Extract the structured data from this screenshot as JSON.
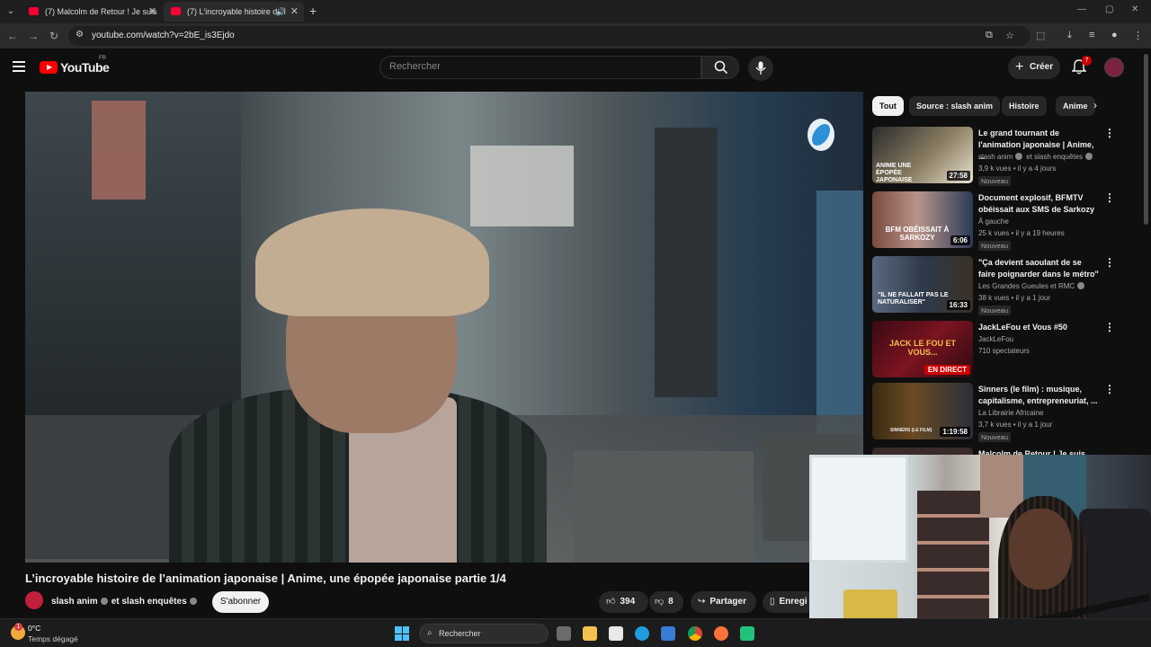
{
  "browser": {
    "tabs": [
      {
        "label": "(7) Malcolm de Retour ! Je suis"
      },
      {
        "label": "(7) L'incroyable histoire de l"
      }
    ],
    "url": "youtube.com/watch?v=2bE_is3Ejdo"
  },
  "header": {
    "logo_text": "YouTube",
    "country": "FR",
    "search_placeholder": "Rechercher",
    "create_label": "Créer",
    "notifications_count": "7"
  },
  "video": {
    "title": "L’incroyable histoire de l’animation japonaise | Anime, une épopée japonaise partie 1/4",
    "channel_name": "slash anim",
    "channel_joiner": "et slash enquêtes",
    "subscribe_label": "S'abonner",
    "likes": "394",
    "dislikes": "8",
    "share_label": "Partager",
    "save_label": "Enregi"
  },
  "chips": [
    "Tout",
    "Source : slash anim",
    "Histoire",
    "Anime"
  ],
  "recommendations": [
    {
      "title": "Le grand tournant de l'animation japonaise | Anime, ...",
      "channel": "slash anim",
      "channel2": "et slash enquêtes",
      "meta": "3,9 k vues • il y a 4 jours",
      "badge": "Nouveau",
      "duration": "27:58",
      "thumb_text": "ANIME UNE ÉPOPÉE JAPONAISE"
    },
    {
      "title": "Document explosif, BFMTV obéissait aux SMS de Sarkozy",
      "channel": "À gauche",
      "meta": "25 k vues • il y a 19 heures",
      "badge": "Nouveau",
      "duration": "6:06",
      "thumb_text": "BFM OBÉISSAIT À SARKOZY"
    },
    {
      "title": "\"Ça devient saoulant de se faire poignarder dans le métro\"",
      "channel": "Les Grandes Gueules et RMC",
      "meta": "38 k vues • il y a 1 jour",
      "badge": "Nouveau",
      "duration": "16:33",
      "thumb_text": "\"IL NE FALLAIT PAS LE NATURALISER\""
    },
    {
      "title": "JackLeFou et Vous #50",
      "channel": "JackLeFou",
      "meta": "710 spectateurs",
      "live": "EN DIRECT",
      "thumb_text": "JACK LE FOU ET VOUS..."
    },
    {
      "title": "Sinners (le film) : musique, capitalisme, entrepreneuriat, ...",
      "channel": "La Librairie Africaine",
      "meta": "3,7 k vues • il y a 1 jour",
      "badge": "Nouveau",
      "duration": "1:19:58",
      "thumb_text": "SINNERS (LE FILM)"
    },
    {
      "title": "Malcolm de Retour ! Je suis"
    }
  ],
  "taskbar": {
    "temperature": "0°C",
    "weather": "Temps dégagé",
    "weather_badge": "1",
    "search_label": "Rechercher"
  }
}
